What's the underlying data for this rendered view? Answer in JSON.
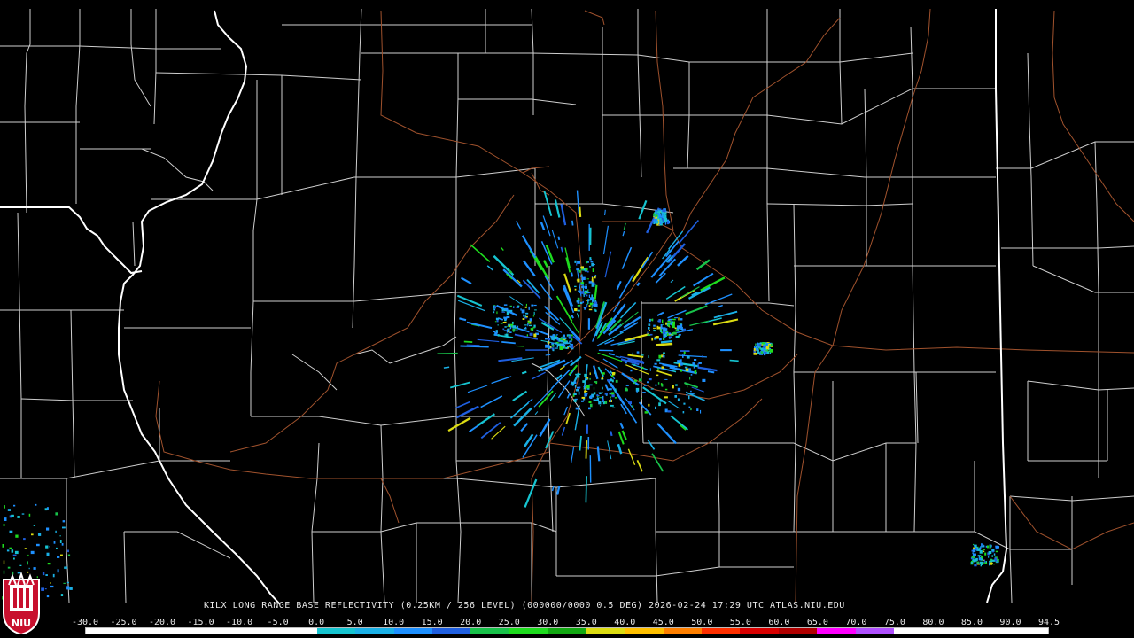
{
  "caption": {
    "radar_id": "KILX",
    "product": "LONG RANGE BASE REFLECTIVITY",
    "resolution": "(0.25KM / 256 LEVEL)",
    "volume": "(000000/0000 0.5 DEG)",
    "date": "2026-02-24",
    "time": "17:29 UTC",
    "source": "ATLAS.NIU.EDU"
  },
  "caption_text": "KILX LONG RANGE BASE REFLECTIVITY (0.25KM / 256 LEVEL) (000000/0000 0.5 DEG) 2026-02-24 17:29 UTC  ATLAS.NIU.EDU",
  "colorbar": {
    "ticks": [
      "-30.0",
      "-25.0",
      "-20.0",
      "-15.0",
      "-10.0",
      "-5.0",
      "0.0",
      "5.0",
      "10.0",
      "15.0",
      "20.0",
      "25.0",
      "30.0",
      "35.0",
      "40.0",
      "45.0",
      "50.0",
      "55.0",
      "60.0",
      "65.0",
      "70.0",
      "75.0",
      "80.0",
      "85.0",
      "90.0",
      "94.5"
    ],
    "colors": [
      "#ffffff",
      "#ffffff",
      "#ffffff",
      "#ffffff",
      "#ffffff",
      "#ffffff",
      "#16c4d0",
      "#1ab0e6",
      "#1e90ff",
      "#1f5fe0",
      "#18c24a",
      "#1edc1e",
      "#12a812",
      "#dcdc12",
      "#ffc000",
      "#ff8000",
      "#ff3000",
      "#d80000",
      "#b00000",
      "#ff00ff",
      "#b050ff",
      "#ffffff",
      "#ffffff",
      "#ffffff",
      "#ffffff"
    ]
  },
  "logo": {
    "text": "NIU"
  },
  "colors": {
    "background": "#000000",
    "county_lines": "#cfcfcf",
    "state_lines": "#ffffff",
    "highways": "#a0522d"
  }
}
